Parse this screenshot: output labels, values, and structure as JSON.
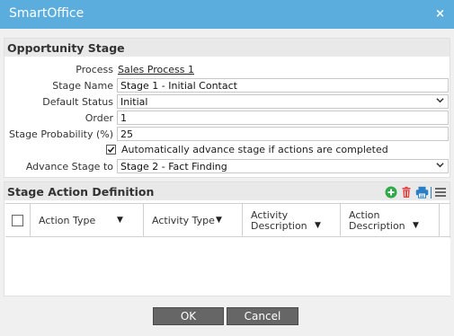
{
  "window": {
    "title": "SmartOffice",
    "close_glyph": "×"
  },
  "stage_panel": {
    "title": "Opportunity Stage",
    "process_label": "Process",
    "process_value": "Sales Process 1",
    "stage_name_label": "Stage Name",
    "stage_name_value": "Stage 1 - Initial Contact",
    "default_status_label": "Default Status",
    "default_status_value": "Initial",
    "order_label": "Order",
    "order_value": "1",
    "probability_label": "Stage Probability (%)",
    "probability_value": "25",
    "auto_advance_label": "Automatically advance stage if actions are completed",
    "auto_advance_checked": true,
    "advance_to_label": "Advance Stage to",
    "advance_to_value": "Stage 2 - Fact Finding"
  },
  "action_panel": {
    "title": "Stage Action Definition",
    "icons": [
      "add-icon",
      "delete-icon",
      "print-icon",
      "menu-icon"
    ],
    "columns": [
      "Action Type",
      "Activity Type",
      "Activity Description",
      "Action Description"
    ],
    "rows": []
  },
  "buttons": {
    "ok": "OK",
    "cancel": "Cancel"
  },
  "colors": {
    "titlebar": "#5aaddd",
    "button": "#666666",
    "add": "#2eaa4a",
    "delete": "#e04040",
    "print": "#2a7fc4"
  }
}
